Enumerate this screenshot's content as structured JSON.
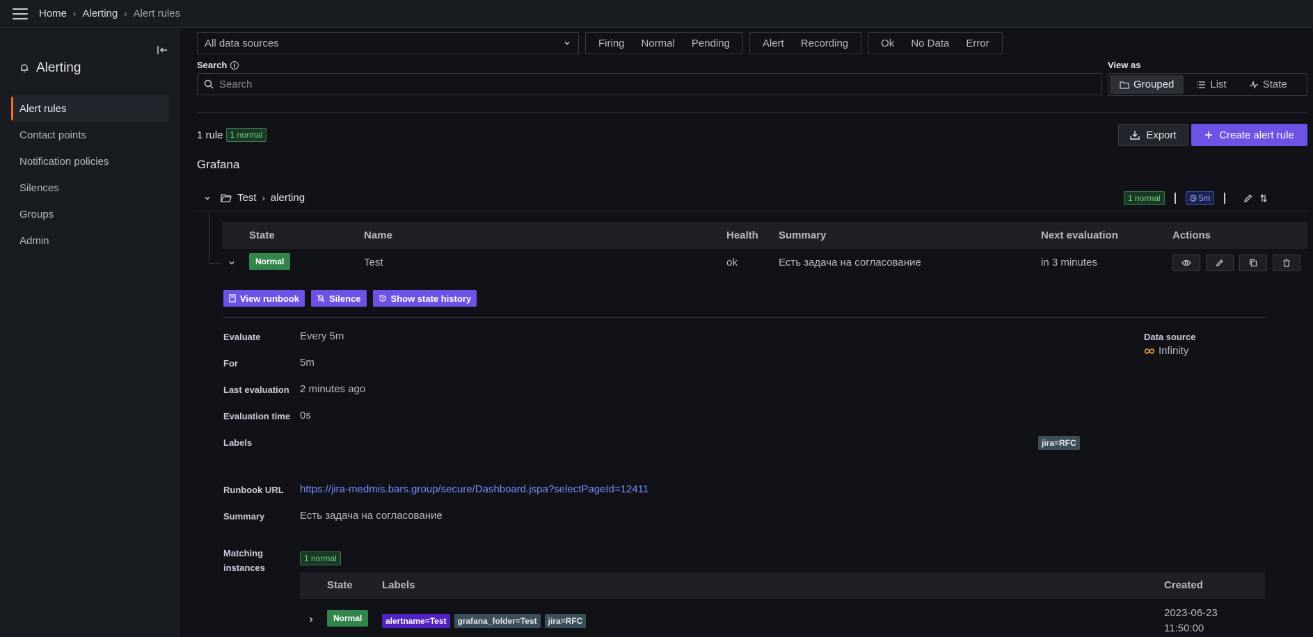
{
  "breadcrumbs": [
    "Home",
    "Alerting",
    "Alert rules"
  ],
  "sidebar": {
    "title": "Alerting",
    "items": [
      {
        "label": "Alert rules",
        "active": true
      },
      {
        "label": "Contact points"
      },
      {
        "label": "Notification policies"
      },
      {
        "label": "Silences"
      },
      {
        "label": "Groups"
      },
      {
        "label": "Admin"
      }
    ]
  },
  "filters": {
    "datasource": "All data sources",
    "state": [
      "Firing",
      "Normal",
      "Pending"
    ],
    "type": [
      "Alert",
      "Recording"
    ],
    "health": [
      "Ok",
      "No Data",
      "Error"
    ]
  },
  "search": {
    "label": "Search",
    "placeholder": "Search"
  },
  "view_as": {
    "label": "View as",
    "options": [
      "Grouped",
      "List",
      "State"
    ],
    "selected": "Grouped"
  },
  "summary": {
    "count": "1 rule",
    "badge": "1 normal"
  },
  "buttons": {
    "export": "Export",
    "create": "Create alert rule"
  },
  "section_title": "Grafana",
  "folder": {
    "name": "Test",
    "group": "alerting",
    "badge": "1 normal",
    "interval": "5m"
  },
  "table": {
    "headers": {
      "state": "State",
      "name": "Name",
      "health": "Health",
      "summary": "Summary",
      "next": "Next evaluation",
      "actions": "Actions"
    },
    "row": {
      "state": "Normal",
      "name": "Test",
      "health": "ok",
      "summary": "Есть задача на согласование",
      "next": "in 3 minutes"
    }
  },
  "detail_buttons": {
    "runbook": "View runbook",
    "silence": "Silence",
    "history": "Show state history"
  },
  "details": {
    "evaluate_label": "Evaluate",
    "evaluate": "Every 5m",
    "for_label": "For",
    "for": "5m",
    "last_label": "Last evaluation",
    "last": "2 minutes ago",
    "time_label": "Evaluation time",
    "time": "0s",
    "labels_label": "Labels",
    "label_chip": "jira=RFC",
    "runbook_label": "Runbook URL",
    "runbook": "https://jira-medmis.bars.group/secure/Dashboard.jspa?selectPageId=12411",
    "summary_label": "Summary",
    "summary": "Есть задача на согласование",
    "ds_label": "Data source",
    "ds": "Infinity",
    "matching_label_1": "Matching",
    "matching_label_2": "instances",
    "matching_badge": "1 normal"
  },
  "instances": {
    "headers": {
      "state": "State",
      "labels": "Labels",
      "created": "Created"
    },
    "row": {
      "state": "Normal",
      "labels": [
        "alertname=Test",
        "grafana_folder=Test",
        "jira=RFC"
      ],
      "created_date": "2023-06-23",
      "created_time": "11:50:00"
    }
  }
}
